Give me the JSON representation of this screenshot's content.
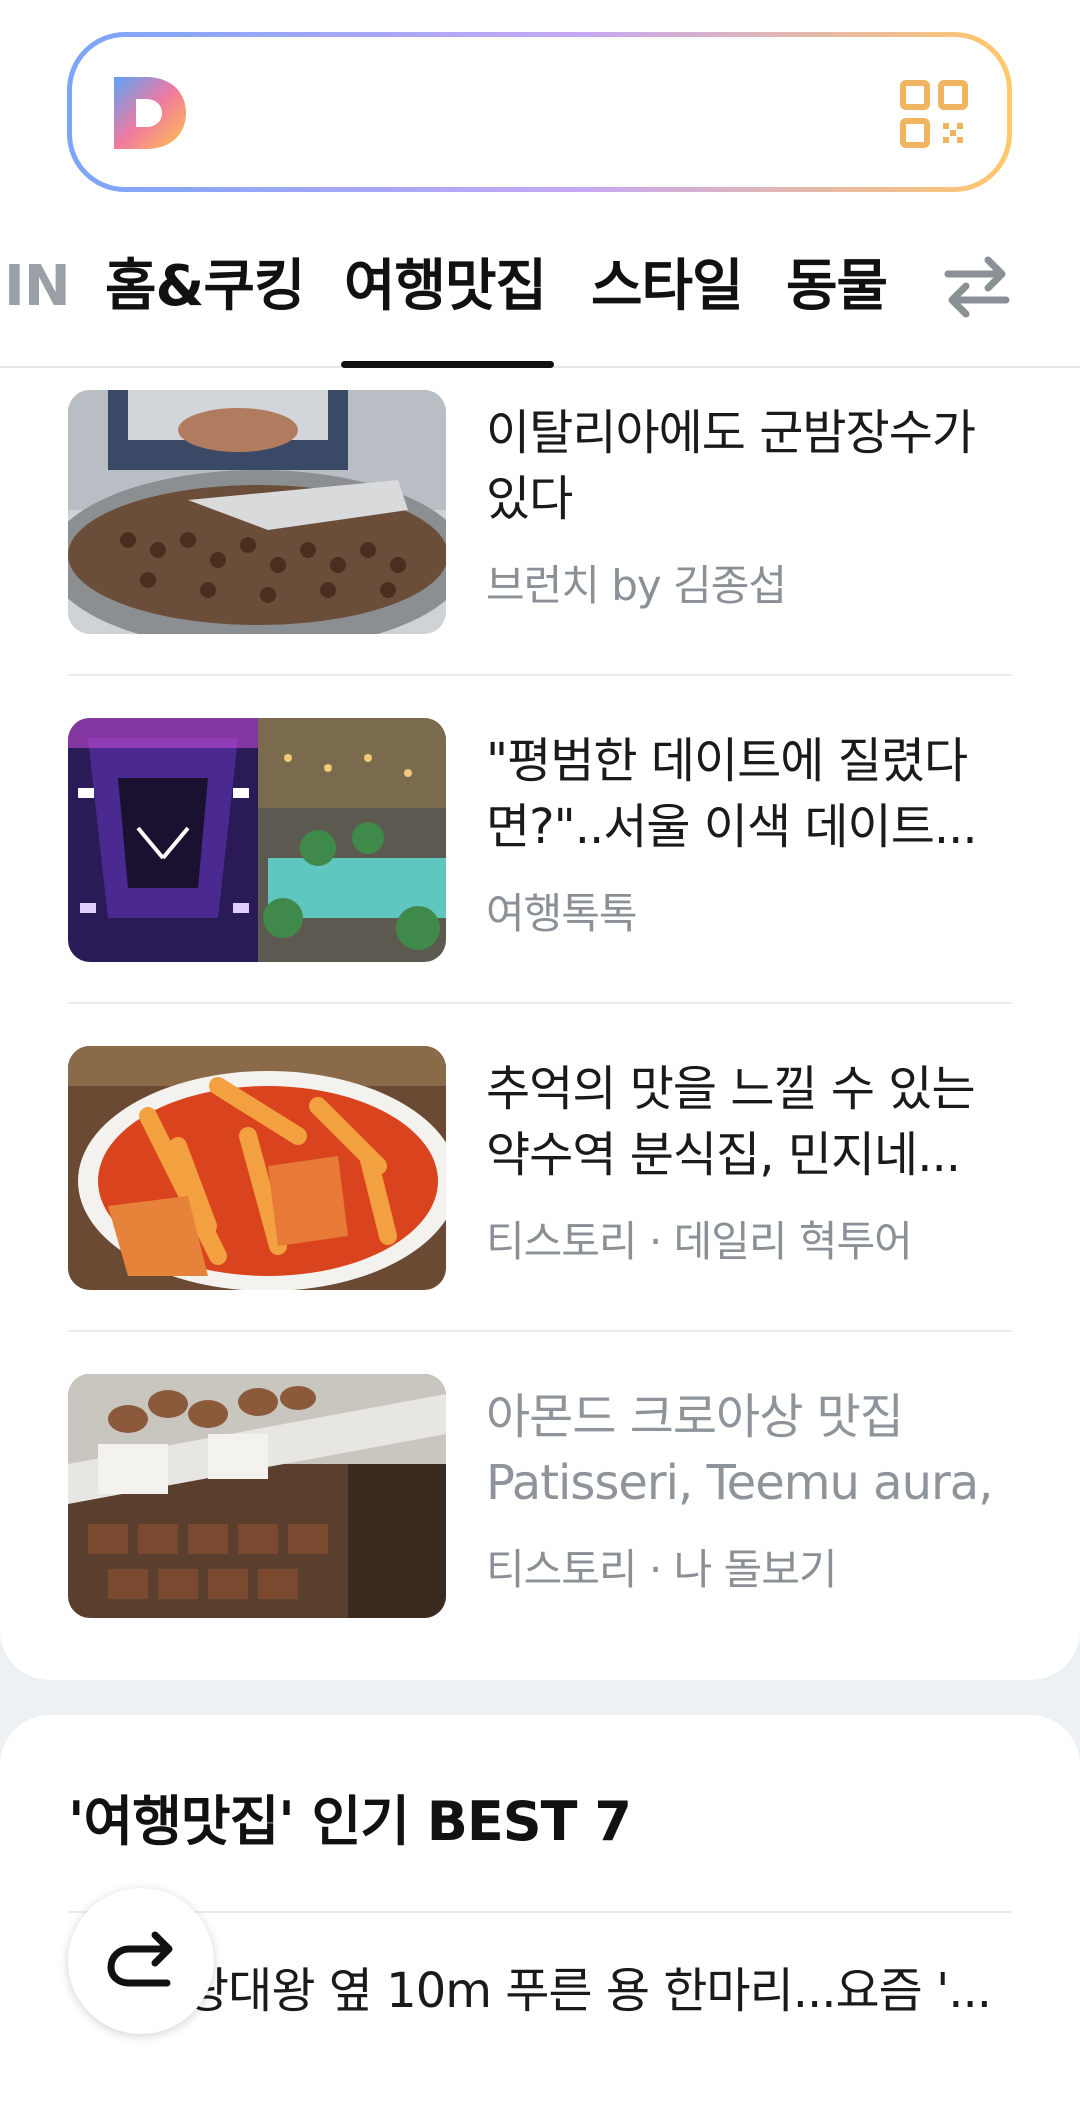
{
  "search": {
    "logo_icon": "daum-d-logo",
    "qr_icon": "qr-code-icon"
  },
  "tabs": [
    {
      "label": "IN",
      "partial": true
    },
    {
      "label": "홈&쿠킹"
    },
    {
      "label": "여행맛집",
      "selected": true
    },
    {
      "label": "스타일"
    },
    {
      "label": "동물"
    }
  ],
  "swap_icon": "swap-arrows-icon",
  "articles": [
    {
      "title": "이탈리아에도 군밤장수가 있다",
      "source": "브런치 by 김종섭",
      "image": "chestnut-vendor"
    },
    {
      "title": "\"평범한 데이트에 질렸다면?\"..서울 이색 데이트...",
      "source": "여행톡톡",
      "image": "neon-date-spot"
    },
    {
      "title": "추억의 맛을 느낄 수 있는 약수역 분식집, 민지네...",
      "source": "티스토리 · 데일리 혁투어",
      "image": "tteokbokki"
    },
    {
      "title": "아몬드 크로아상 맛집 Patisseri, Teemu aura, ...",
      "source": "티스토리 · 나 돌보기",
      "image": "bakery-display",
      "read": true
    }
  ],
  "best": {
    "title": "'여행맛집' 인기 BEST 7",
    "first_item": "광대왕 옆 10m 푸른 용 한마리...요즘 '..."
  },
  "fab_icon": "share-redo-icon"
}
